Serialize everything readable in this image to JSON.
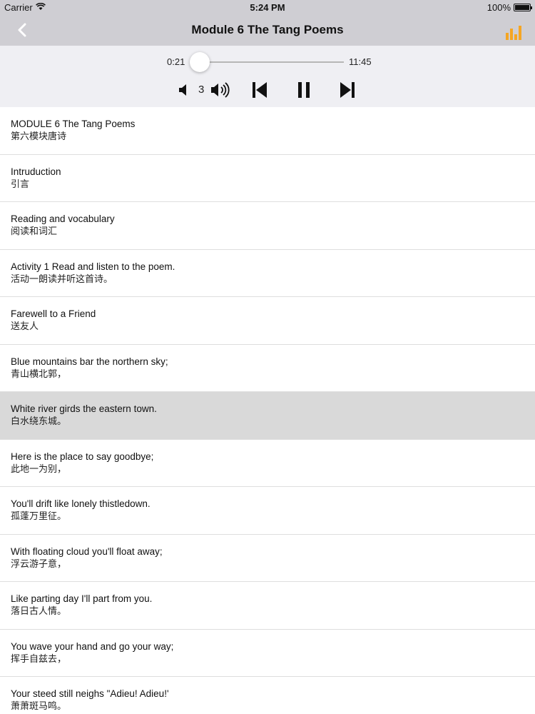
{
  "status_bar": {
    "carrier": "Carrier",
    "time": "5:24 PM",
    "battery": "100%"
  },
  "nav": {
    "title": "Module 6 The Tang Poems",
    "accent_color": "#f5a623"
  },
  "player": {
    "current_time": "0:21",
    "total_time": "11:45",
    "progress": 0.03,
    "volume": "3",
    "state": "playing"
  },
  "list": {
    "selected_index": 6,
    "items": [
      {
        "en": "MODULE 6 The Tang Poems",
        "zh": "第六模块唐诗"
      },
      {
        "en": "Intruduction",
        "zh": "引言"
      },
      {
        "en": "Reading and vocabulary",
        "zh": "阅读和词汇"
      },
      {
        "en": "Activity 1 Read and listen to the poem.",
        "zh": "活动一朗读并听这首诗。"
      },
      {
        "en": "Farewell to a Friend",
        "zh": "送友人"
      },
      {
        "en": "Blue mountains bar the northern sky;",
        "zh": "青山横北郭，"
      },
      {
        "en": "White river girds the eastern town.",
        "zh": "白水绕东城。"
      },
      {
        "en": "Here is the place to say goodbye;",
        "zh": "此地一为别，"
      },
      {
        "en": "You'll drift like lonely thistledown.",
        "zh": "孤蓬万里征。"
      },
      {
        "en": "With floating cloud you'll float away;",
        "zh": "浮云游子意，"
      },
      {
        "en": "Like parting day I'll part from you.",
        "zh": "落日古人情。"
      },
      {
        "en": "You wave your hand and go your way;",
        "zh": "挥手自兹去，"
      },
      {
        "en": "Your steed still neighs \"Adieu! Adieu!'",
        "zh": "萧萧斑马鸣。"
      }
    ]
  }
}
